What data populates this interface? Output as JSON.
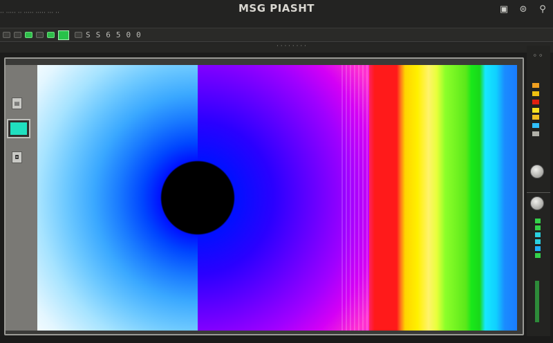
{
  "window": {
    "title": "MSG PIASHT",
    "top_left_text": "·· ·····  ·· ····· ····· ··· ··",
    "icons": [
      "window-icon",
      "stack-icon",
      "pin-icon"
    ]
  },
  "toolbar": {
    "glyphs": [
      "S",
      "S",
      "6",
      "5",
      "0",
      "0"
    ]
  },
  "status": {
    "text": "· · · · · · · ·"
  },
  "left_panel": {
    "swatch_color": "#20e0c0"
  },
  "right_bar": {
    "top_label": "◦◦",
    "chip_colors": [
      "#f0a020",
      "#f0c010",
      "#e02010",
      "#f5e020",
      "#f0c020",
      "#30c0ff",
      "#b0b0a8"
    ],
    "meter_colors": [
      "#34d14a",
      "#34d14a",
      "#2ad0e0",
      "#2ad0e0",
      "#20b0ff",
      "#34d14a",
      "#34d14a"
    ]
  },
  "canvas": {
    "description_colors": [
      "#ffffff",
      "#3aa8ff",
      "#0012ff",
      "#a000ff",
      "#ff1a1a",
      "#fff000",
      "#19e81a",
      "#10d0ff"
    ]
  }
}
